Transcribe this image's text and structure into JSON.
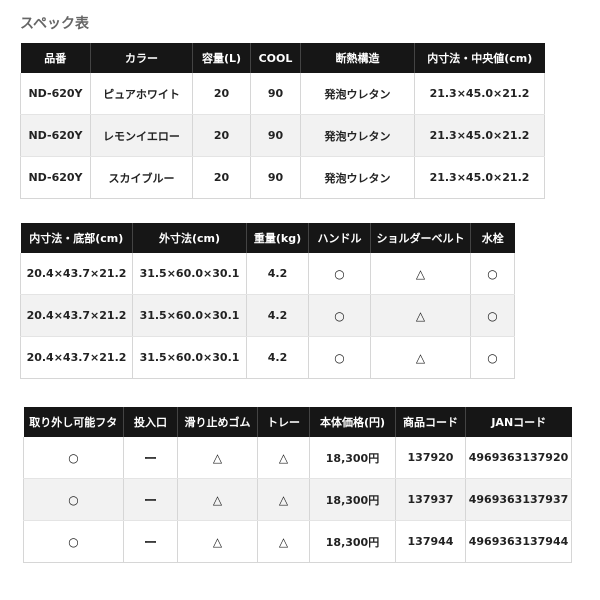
{
  "title": "スペック表",
  "table1": {
    "headers": [
      "品番",
      "カラー",
      "容量(L)",
      "COOL",
      "断熱構造",
      "内寸法・中央値(cm)"
    ],
    "rows": [
      [
        "ND-620Y",
        "ピュアホワイト",
        "20",
        "90",
        "発泡ウレタン",
        "21.3×45.0×21.2"
      ],
      [
        "ND-620Y",
        "レモンイエロー",
        "20",
        "90",
        "発泡ウレタン",
        "21.3×45.0×21.2"
      ],
      [
        "ND-620Y",
        "スカイブルー",
        "20",
        "90",
        "発泡ウレタン",
        "21.3×45.0×21.2"
      ]
    ]
  },
  "table2": {
    "headers": [
      "内寸法・底部(cm)",
      "外寸法(cm)",
      "重量(kg)",
      "ハンドル",
      "ショルダーベルト",
      "水栓"
    ],
    "rows": [
      [
        "20.4×43.7×21.2",
        "31.5×60.0×30.1",
        "4.2",
        "○",
        "△",
        "○"
      ],
      [
        "20.4×43.7×21.2",
        "31.5×60.0×30.1",
        "4.2",
        "○",
        "△",
        "○"
      ],
      [
        "20.4×43.7×21.2",
        "31.5×60.0×30.1",
        "4.2",
        "○",
        "△",
        "○"
      ]
    ]
  },
  "table3": {
    "headers": [
      "取り外し可能フタ",
      "投入口",
      "滑り止めゴム",
      "トレー",
      "本体価格(円)",
      "商品コード",
      "JANコード"
    ],
    "rows": [
      [
        "○",
        "ー",
        "△",
        "△",
        "18,300円",
        "137920",
        "4969363137920"
      ],
      [
        "○",
        "ー",
        "△",
        "△",
        "18,300円",
        "137937",
        "4969363137937"
      ],
      [
        "○",
        "ー",
        "△",
        "△",
        "18,300円",
        "137944",
        "4969363137944"
      ]
    ]
  }
}
